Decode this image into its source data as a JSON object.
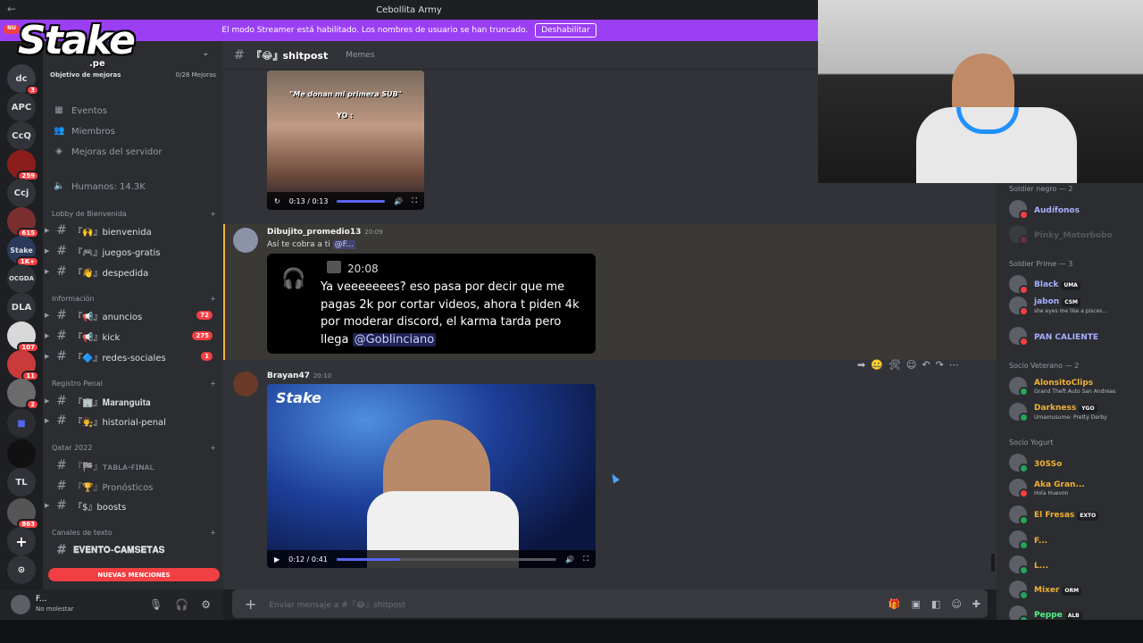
{
  "window": {
    "title": "Cebollita Army",
    "nav": "←"
  },
  "streamer_banner": {
    "text": "El modo Streamer está habilitado. Los nombres de usuario se han truncado.",
    "button": "Deshabilitar"
  },
  "overlay": {
    "brand": "Stake",
    "brand_suffix": ".pe"
  },
  "guilds": [
    {
      "label": "NU",
      "badge": ""
    },
    {
      "label": "dc",
      "badge": "3"
    },
    {
      "label": "APC",
      "badge": ""
    },
    {
      "label": "CcQ",
      "badge": ""
    },
    {
      "label": "",
      "badge": "259"
    },
    {
      "label": "Ccj",
      "badge": ""
    },
    {
      "label": "",
      "badge": "615"
    },
    {
      "label": "Stake",
      "badge": "1K+"
    },
    {
      "label": "OCGDA",
      "badge": ""
    },
    {
      "label": "DLA",
      "badge": ""
    },
    {
      "label": "",
      "badge": "107"
    },
    {
      "label": "",
      "badge": "11"
    },
    {
      "label": "",
      "badge": "2"
    },
    {
      "label": "",
      "badge": ""
    },
    {
      "label": "",
      "badge": ""
    },
    {
      "label": "TL",
      "badge": ""
    },
    {
      "label": "",
      "badge": "863"
    },
    {
      "label": "+",
      "badge": ""
    },
    {
      "label": "⊙",
      "badge": ""
    }
  ],
  "sidebar": {
    "goal_label": "Objetivo de mejoras",
    "goal_value": "0/28 Mejoras",
    "menu": [
      {
        "icon": "calendar-icon",
        "label": "Eventos"
      },
      {
        "icon": "members-icon",
        "label": "Miembros"
      },
      {
        "icon": "boost-icon",
        "label": "Mejoras del servidor"
      }
    ],
    "humans": "Humanos: 14.3K",
    "categories": [
      {
        "name": "Lobby de Bienvenida",
        "channels": [
          {
            "name": "『🙌』bienvenida",
            "count": ""
          },
          {
            "name": "『🎮』juegos-gratis",
            "count": ""
          },
          {
            "name": "『👋』despedida",
            "count": ""
          }
        ]
      },
      {
        "name": "Información",
        "channels": [
          {
            "name": "『📢』anuncios",
            "count": "72"
          },
          {
            "name": "『📢』kick",
            "count": "275"
          },
          {
            "name": "『🔷』redes-sociales",
            "count": "1"
          }
        ]
      },
      {
        "name": "Registro Penal",
        "channels": [
          {
            "name": "『🏢』𝐌𝐚𝐫𝐚𝐧𝐠𝐮𝐢𝐭𝐚",
            "count": ""
          },
          {
            "name": "『👨‍⚖️』historial-penal",
            "count": ""
          }
        ]
      },
      {
        "name": "Qatar 2022",
        "channels": [
          {
            "name": "『🏁』ᴛᴀʙʟᴀ-ꜰɪɴᴀʟ",
            "count": ""
          },
          {
            "name": "『🏆』Pronósticos",
            "count": ""
          },
          {
            "name": "『$』boosts",
            "count": ""
          }
        ]
      },
      {
        "name": "Canales de texto",
        "channels": [
          {
            "name": "𝐄𝐕𝐄𝐍𝐓𝐎-𝐂𝐀𝐌𝐒𝐄𝐓𝐀𝐒",
            "count": ""
          }
        ]
      }
    ],
    "mentions": "NUEVAS MENCIONES",
    "user": {
      "name": "F...",
      "status": "No molestar"
    }
  },
  "chat": {
    "channel": "『😂』shitpost",
    "topic": "Memes",
    "video1": {
      "caption": "\"Me donan mi primera SUB\"",
      "caption2": "YO :",
      "time": "0:13 / 0:13",
      "progress": 1.0
    },
    "msg1": {
      "author": "Dibujito_promedio13",
      "time": "20:09",
      "text": "Así te cobra a ti",
      "mention": "@F..."
    },
    "quote": {
      "time": "20:08",
      "text": "Ya veeeeeees? eso pasa por decir que me pagas 2k por cortar videos, ahora t piden 4k por moderar discord, el karma tarda pero llega",
      "mention": "@Goblinciano"
    },
    "msg2": {
      "author": "Brayan47",
      "time": "20:10"
    },
    "video2": {
      "watermark": "Stake",
      "time": "0:12 / 0:41",
      "progress": 0.29
    },
    "input_placeholder": "Enviar mensaje a #『😂』shitpost"
  },
  "members": {
    "groups": [
      {
        "name": "Soldier negro — 2",
        "members": [
          {
            "name": "Audífonos",
            "color": "#a5b0ff",
            "tag": "",
            "status": ""
          },
          {
            "name": "Pinky_Motorbobo",
            "color": "#b5bac1",
            "tag": "",
            "status": ""
          }
        ]
      },
      {
        "name": "Soldier Prime — 3",
        "members": [
          {
            "name": "Black",
            "color": "#a5b0ff",
            "tag": "UMA",
            "status": ""
          },
          {
            "name": "jabon",
            "color": "#a5b0ff",
            "tag": "CSM",
            "status": "she eyes me like a pisces..."
          },
          {
            "name": "PAN CALIENTE",
            "color": "#a5b0ff",
            "tag": "",
            "status": ""
          }
        ]
      },
      {
        "name": "Socio Veterano — 2",
        "members": [
          {
            "name": "AlonsitoClips",
            "color": "#f0b232",
            "tag": "",
            "status": "Grand Theft Auto San Andreas"
          },
          {
            "name": "Darkness",
            "color": "#f0b232",
            "tag": "YGO",
            "status": "Umamusume: Pretty Derby"
          }
        ]
      },
      {
        "name": "Socio Yogurt",
        "members": [
          {
            "name": "30SSo",
            "color": "#f0b232",
            "tag": "",
            "status": ""
          },
          {
            "name": "Aka Gran...",
            "color": "#f0b232",
            "tag": "",
            "status": "Hola Huevon"
          },
          {
            "name": "El Fresas",
            "color": "#f0b232",
            "tag": "EXTO",
            "status": ""
          },
          {
            "name": "F...",
            "color": "#f0b232",
            "tag": "",
            "status": ""
          },
          {
            "name": "L...",
            "color": "#f0b232",
            "tag": "",
            "status": ""
          },
          {
            "name": "Mixer",
            "color": "#f0b232",
            "tag": "ORM",
            "status": ""
          },
          {
            "name": "Peppe",
            "color": "#57f287",
            "tag": "ALB",
            "status": ""
          }
        ]
      }
    ]
  },
  "colors": {
    "accent": "#5865f2",
    "streamer": "#9b3ff5",
    "danger": "#f23f43"
  }
}
